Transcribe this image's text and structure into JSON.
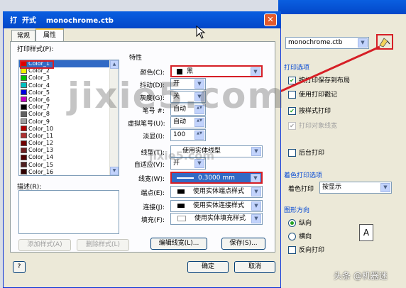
{
  "background_dialog": {
    "plotter_value": "monochrome.ctb",
    "print_options_title": "打印选项",
    "options": [
      {
        "label": "按打印保存到布局",
        "checked": true,
        "disabled": false
      },
      {
        "label": "使用打印戳记",
        "checked": false,
        "disabled": false
      },
      {
        "label": "按样式打印",
        "checked": true,
        "disabled": false
      },
      {
        "label": "打印对象线宽",
        "checked": true,
        "disabled": true
      }
    ],
    "backstage_print": "后台打印",
    "shaded_title": "着色打印选项",
    "shade_label": "着色打印",
    "shade_value": "按显示",
    "orientation_title": "图形方向",
    "portrait": "纵向",
    "landscape": "横向",
    "reverse": "反向打印",
    "portrait_icon": "A"
  },
  "dialog": {
    "title": "打  开式    monochrome.ctb",
    "close_glyph": "✕",
    "tabs": [
      {
        "label": "常规"
      },
      {
        "label": "属性"
      }
    ],
    "styles_label": "打印样式(P):",
    "styles": [
      {
        "name": "Color_1",
        "color": "#e00000",
        "selected": true
      },
      {
        "name": "Color_2",
        "color": "#f0f000"
      },
      {
        "name": "Color_3",
        "color": "#00c000"
      },
      {
        "name": "Color_4",
        "color": "#00c0c0"
      },
      {
        "name": "Color_5",
        "color": "#0000e0"
      },
      {
        "name": "Color_6",
        "color": "#c000c0"
      },
      {
        "name": "Color_7",
        "color": "#000000"
      },
      {
        "name": "Color_8",
        "color": "#606060"
      },
      {
        "name": "Color_9",
        "color": "#a0a0a0"
      },
      {
        "name": "Color_10",
        "color": "#b00000"
      },
      {
        "name": "Color_11",
        "color": "#b03030"
      },
      {
        "name": "Color_12",
        "color": "#700000"
      },
      {
        "name": "Color_13",
        "color": "#702020"
      },
      {
        "name": "Color_14",
        "color": "#500000"
      },
      {
        "name": "Color_15",
        "color": "#502020"
      },
      {
        "name": "Color_16",
        "color": "#300000"
      }
    ],
    "desc_label": "描述(R):",
    "properties_label": "特性",
    "props": [
      {
        "key": "color",
        "label": "颜色(C):",
        "value": "黑"
      },
      {
        "key": "dither",
        "label": "抖动(D):",
        "value": "开"
      },
      {
        "key": "gray",
        "label": "灰度(G):",
        "value": "关"
      },
      {
        "key": "pen",
        "label": "笔号 #:",
        "value": "自动"
      },
      {
        "key": "vpen",
        "label": "虚拟笔号(U):",
        "value": "自动"
      },
      {
        "key": "screen",
        "label": "淡显(I):",
        "value": "100"
      },
      {
        "key": "linetype",
        "label": "线型(T):",
        "value": "使用实体线型"
      },
      {
        "key": "adaptive",
        "label": "自适应(V):",
        "value": "开"
      },
      {
        "key": "lineweight",
        "label": "线宽(W):",
        "value": "0.3000 mm"
      },
      {
        "key": "endcap",
        "label": "端点(E):",
        "value": "使用实体端点样式"
      },
      {
        "key": "join",
        "label": "连接(J):",
        "value": "使用实体连接样式"
      },
      {
        "key": "fill",
        "label": "填充(F):",
        "value": "使用实体填充样式"
      }
    ],
    "add_style": "添加样式(A)",
    "delete_style": "删除样式(L)",
    "edit_lineweights": "编辑线宽(L)...",
    "save_as": "保存(S)...",
    "help_glyph": "?",
    "ok": "确定",
    "cancel": "取消"
  },
  "watermarks": {
    "main": "jixie5.com",
    "sub": "jixie5.com",
    "footer": "头条 @机器迷"
  }
}
